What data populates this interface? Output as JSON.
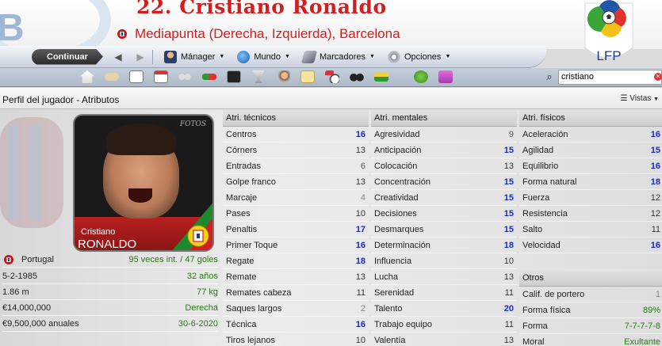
{
  "header": {
    "title": "22. Cristiano Ronaldo",
    "subtitle": "Mediapunta (Derecha, Izquierda), Barcelona",
    "club_letter": "B",
    "league_logo_text": "LFP"
  },
  "nav": {
    "continue_label": "Continuar",
    "menus": [
      {
        "label": "Mánager",
        "icon": "manager-icon"
      },
      {
        "label": "Mundo",
        "icon": "globe-icon"
      },
      {
        "label": "Marcadores",
        "icon": "scores-icon"
      },
      {
        "label": "Opciones",
        "icon": "options-icon"
      }
    ]
  },
  "search": {
    "value": "cristiano",
    "placeholder": ""
  },
  "subheader": {
    "title": "Perfil del jugador - Atributos",
    "views_label": "Vistas"
  },
  "photo": {
    "first_name": "Cristiano",
    "last_name": "RONALDO",
    "watermark": "FOTOS"
  },
  "player_info": [
    {
      "left": "Portugal",
      "right": "95 veces int. / 47 goles",
      "flag": true
    },
    {
      "left": "5-2-1985",
      "right": "32 años"
    },
    {
      "left": "1.86 m",
      "right": "77 kg"
    },
    {
      "left": "€14,000,000",
      "right": "Derecha"
    },
    {
      "left": "€9,500,000 anuales",
      "right": "30-6-2020"
    }
  ],
  "columns": {
    "technical": {
      "title": "Atri. técnicos",
      "rows": [
        {
          "name": "Centros",
          "value": "16"
        },
        {
          "name": "Córners",
          "value": "13"
        },
        {
          "name": "Entradas",
          "value": "6"
        },
        {
          "name": "Golpe franco",
          "value": "13"
        },
        {
          "name": "Marcaje",
          "value": "4"
        },
        {
          "name": "Pases",
          "value": "10"
        },
        {
          "name": "Penaltis",
          "value": "17"
        },
        {
          "name": "Primer Toque",
          "value": "16"
        },
        {
          "name": "Regate",
          "value": "18"
        },
        {
          "name": "Remate",
          "value": "13"
        },
        {
          "name": "Remates cabeza",
          "value": "11"
        },
        {
          "name": "Saques largos",
          "value": "2"
        },
        {
          "name": "Técnica",
          "value": "16"
        },
        {
          "name": "Tiros lejanos",
          "value": "10"
        }
      ]
    },
    "mental": {
      "title": "Atri. mentales",
      "rows": [
        {
          "name": "Agresividad",
          "value": "9"
        },
        {
          "name": "Anticipación",
          "value": "15"
        },
        {
          "name": "Colocación",
          "value": "13"
        },
        {
          "name": "Concentración",
          "value": "15"
        },
        {
          "name": "Creatividad",
          "value": "15"
        },
        {
          "name": "Decisiones",
          "value": "15"
        },
        {
          "name": "Desmarques",
          "value": "15"
        },
        {
          "name": "Determinación",
          "value": "18"
        },
        {
          "name": "Influencia",
          "value": "10"
        },
        {
          "name": "Lucha",
          "value": "13"
        },
        {
          "name": "Serenidad",
          "value": "11"
        },
        {
          "name": "Talento",
          "value": "20"
        },
        {
          "name": "Trabajo equipo",
          "value": "11"
        },
        {
          "name": "Valentía",
          "value": "13"
        }
      ]
    },
    "physical": {
      "title": "Atri. físicos",
      "rows": [
        {
          "name": "Aceleración",
          "value": "16"
        },
        {
          "name": "Agilidad",
          "value": "15"
        },
        {
          "name": "Equilibrio",
          "value": "16"
        },
        {
          "name": "Forma natural",
          "value": "18"
        },
        {
          "name": "Fuerza",
          "value": "12"
        },
        {
          "name": "Resistencia",
          "value": "12"
        },
        {
          "name": "Salto",
          "value": "11"
        },
        {
          "name": "Velocidad",
          "value": "16"
        }
      ]
    },
    "other": {
      "title": "Otros",
      "rows": [
        {
          "name": "Calif. de portero",
          "value": "1"
        },
        {
          "name": "Forma física",
          "value": "89%"
        },
        {
          "name": "Forma",
          "value": "7-7-7-7-8"
        },
        {
          "name": "Moral",
          "value": "Exultante"
        }
      ]
    }
  },
  "colors": {
    "title_red": "#d21e1e",
    "value_blue": "#1c2ab8",
    "value_green": "#2a7a17"
  }
}
